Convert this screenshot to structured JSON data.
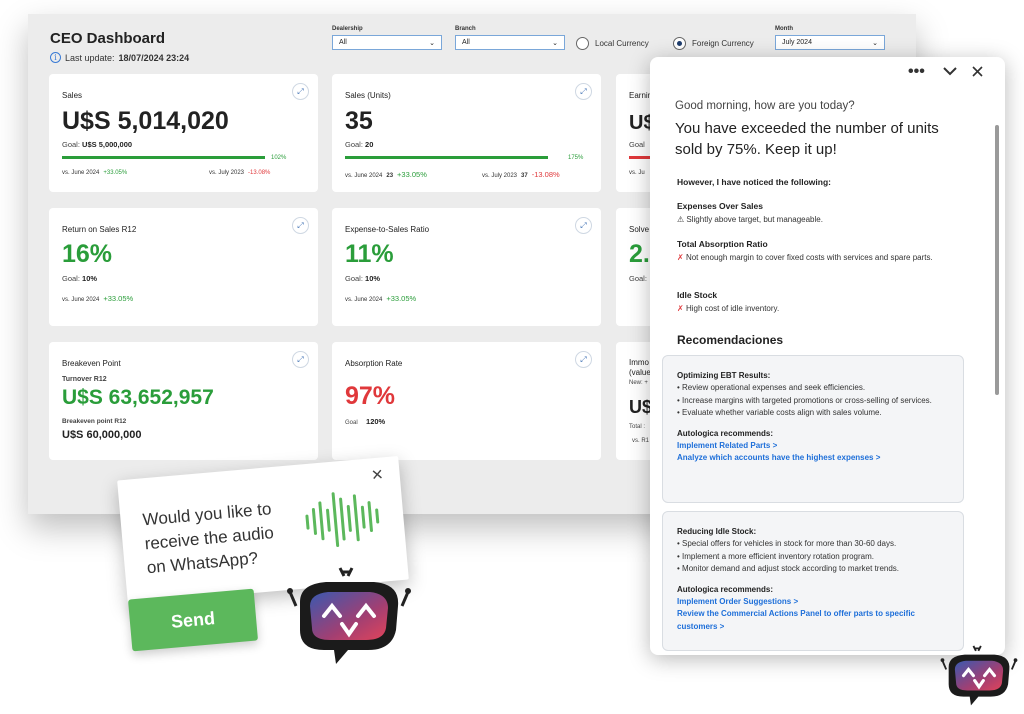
{
  "dashboard": {
    "title": "CEO Dashboard",
    "last_update_label": "Last update:",
    "last_update_value": "18/07/2024 23:24",
    "filters": {
      "dealership": {
        "label": "Dealership",
        "value": "All"
      },
      "branch": {
        "label": "Branch",
        "value": "All"
      },
      "local_currency": "Local Currency",
      "foreign_currency": "Foreign Currency",
      "month": {
        "label": "Month",
        "value": "July 2024"
      }
    },
    "cards": {
      "sales": {
        "title": "Sales",
        "value": "U$S 5,014,020",
        "goal_label": "Goal:",
        "goal_value": "U$S 5,000,000",
        "progress_label": "102%",
        "progress": 1.02,
        "vs1_label": "vs. June 2024",
        "vs1_value": "+33.05%",
        "vs2_label": "vs. July 2023",
        "vs2_value": "-13.08%"
      },
      "sales_units": {
        "title": "Sales (Units)",
        "value": "35",
        "goal_label": "Goal:",
        "goal_value": "20",
        "progress_label": "175%",
        "progress": 1.75,
        "vs1_label": "vs. June 2024",
        "vs1_num": "23",
        "vs1_value": "+33.05%",
        "vs2_label": "vs. July 2023",
        "vs2_num": "37",
        "vs2_value": "-13.08%"
      },
      "earnings": {
        "title": "Earnin",
        "value": "U$",
        "goal_label": "Goal",
        "vs_label": "vs. Ju"
      },
      "ros": {
        "title": "Return on Sales R12",
        "value": "16%",
        "goal_label": "Goal:",
        "goal_value": "10%",
        "vs1_label": "vs. June 2024",
        "vs1_value": "+33.05%"
      },
      "expense": {
        "title": "Expense-to-Sales Ratio",
        "value": "11%",
        "goal_label": "Goal:",
        "goal_value": "10%",
        "vs1_label": "vs. June 2024",
        "vs1_value": "+33.05%"
      },
      "solvency": {
        "title": "Solve",
        "value": "2.",
        "goal_label": "Goal:"
      },
      "breakeven": {
        "title": "Breakeven Point",
        "turnover_label": "Turnover R12",
        "turnover_value": "U$S 63,652,957",
        "bp_label": "Breakeven point R12",
        "bp_value": "U$S 60,000,000"
      },
      "absorption": {
        "title": "Absorption Rate",
        "value": "97%",
        "goal_label": "Goal",
        "goal_value": "120%"
      },
      "immo": {
        "title1": "Immo",
        "title2": "(value",
        "new_label": "New: +",
        "value": "U$",
        "total_label": "Total :",
        "vs_label": "vs. R1"
      }
    }
  },
  "assistant": {
    "greeting": "Good morning, how are you today?",
    "headline": "You have exceeded the number of units sold by 75%. Keep it up!",
    "noticed": "However, I have noticed the following:",
    "items": [
      {
        "title": "Expenses Over Sales",
        "icon": "⚠️",
        "text": "Slightly above target, but manageable."
      },
      {
        "title": "Total Absorption Ratio",
        "icon": "✗",
        "text": "Not enough margin to cover fixed costs with services and spare parts."
      },
      {
        "title": "Idle Stock",
        "icon": "✗",
        "text": "High cost of idle inventory."
      }
    ],
    "reco_title": "Recomendaciones",
    "boxes": [
      {
        "title": "Optimizing EBT Results:",
        "bullets": [
          "• Review operational expenses and seek efficiencies.",
          "• Increase margins with targeted promotions or cross-selling of services.",
          "• Evaluate whether variable costs align with sales volume."
        ],
        "recommends": "Autologica recommends:",
        "links": [
          "Implement Related Parts >",
          "Analyze which accounts have the highest expenses >"
        ]
      },
      {
        "title": "Reducing Idle Stock:",
        "bullets": [
          "• Special offers for vehicles in stock for more than 30-60 days.",
          "• Implement a more efficient inventory rotation program.",
          "• Monitor demand and adjust stock according to market trends."
        ],
        "recommends": "Autologica recommends:",
        "links": [
          "Implement Order Suggestions >",
          "Review the Commercial Actions Panel to offer parts to specific customers >"
        ]
      }
    ]
  },
  "whatsapp": {
    "question": "Would you like to receive the audio on WhatsApp?",
    "send": "Send"
  },
  "colors": {
    "green": "#2a9d3a",
    "red": "#e0383b",
    "link": "#1e6fd9",
    "send": "#5cb85c"
  }
}
